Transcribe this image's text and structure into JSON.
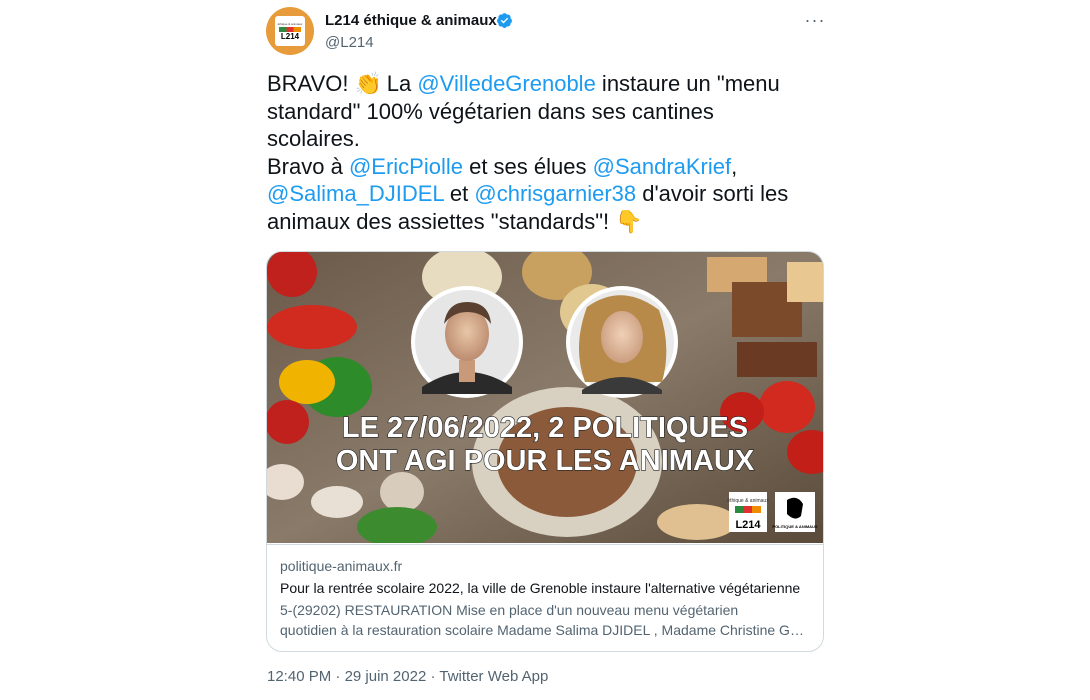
{
  "author": {
    "name": "L214 éthique & animaux",
    "handle": "@L214",
    "avatar_text": "L214",
    "avatar_tagline": "éthique & animaux"
  },
  "tweet": {
    "line1_a": "BRAVO! ",
    "emoji_clap": "👏",
    "line1_b": " La ",
    "mention_ville": "@VilledeGrenoble",
    "line1_c": " instaure un \"menu",
    "line2": "standard\" 100% végétarien dans ses cantines",
    "line3": "scolaires.",
    "line4_a": "Bravo à ",
    "mention_eric": "@EricPiolle",
    "line4_b": " et ses élues ",
    "mention_sandra": "@SandraKrief",
    "line4_c": ",",
    "mention_salima": "@Salima_DJIDEL",
    "line5_b": " et ",
    "mention_chris": "@chrisgarnier38",
    "line5_c": " d'avoir sorti les",
    "line6": "animaux des assiettes \"standards\"! ",
    "emoji_point": "👇"
  },
  "card": {
    "banner_line1": "LE 27/06/2022, 2 POLITIQUES",
    "banner_line2": "ONT AGI POUR LES ANIMAUX",
    "logo_l214_text": "L214",
    "logo_l214_tag": "éthique & animaux",
    "logo_pa_text": "POLITIQUE & ANIMAUX",
    "domain": "politique-animaux.fr",
    "title": "Pour la rentrée scolaire 2022, la ville de Grenoble instaure l'alternative végétarienne",
    "desc_line1": "5-(29202) RESTAURATION Mise en place d'un nouveau menu végétarien",
    "desc_line2": "quotidien à la restauration scolaire Madame Salima DJIDEL , Madame Christine Garnier"
  },
  "footer": {
    "time": "12:40 PM",
    "sep1": " · ",
    "date": "29 juin 2022",
    "sep2": " · ",
    "source": "Twitter Web App"
  },
  "colors": {
    "link": "#1d9bf0",
    "text": "#0f1419",
    "muted": "#536471",
    "border": "#cfd9de",
    "avatar_bg": "#e89b3a"
  },
  "icons": [
    "verified-badge-icon",
    "more-options-icon",
    "clapping-hands-emoji",
    "pointing-down-emoji"
  ]
}
